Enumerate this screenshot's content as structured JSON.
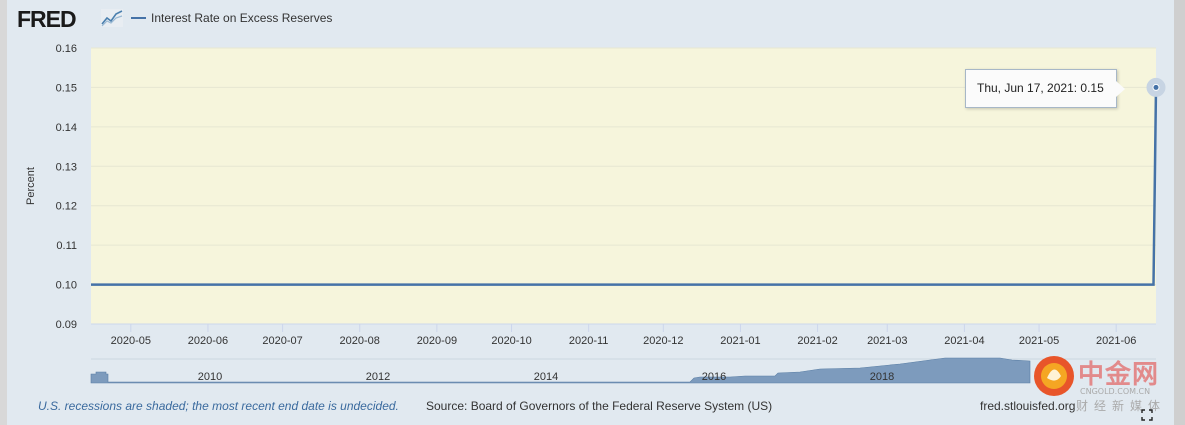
{
  "header": {
    "logo_text": "FRED",
    "legend_label": "Interest Rate on Excess Reserves",
    "series_color": "#4572a7"
  },
  "tooltip": {
    "date": "Thu, Jun 17, 2021",
    "value": "0.15"
  },
  "footer": {
    "note": "U.S. recessions are shaded; the most recent end date is undecided.",
    "source": "Source: Board of Governors of the Federal Reserve System (US)",
    "url": "fred.stlouisfed.org"
  },
  "watermark": {
    "cn": "中金网",
    "url": "CNGOLD.COM.CN",
    "sub": "财经新媒体"
  },
  "chart_data": {
    "type": "line",
    "title": "",
    "xlabel": "",
    "ylabel": "Percent",
    "ylim": [
      0.09,
      0.16
    ],
    "yticks": [
      "0.09",
      "0.10",
      "0.11",
      "0.12",
      "0.13",
      "0.14",
      "0.15",
      "0.16"
    ],
    "xticks": [
      "2020-05",
      "2020-06",
      "2020-07",
      "2020-08",
      "2020-09",
      "2020-10",
      "2020-11",
      "2020-12",
      "2021-01",
      "2021-02",
      "2021-03",
      "2021-04",
      "2021-05",
      "2021-06"
    ],
    "xlim": [
      "2020-04-15",
      "2021-06-17"
    ],
    "plot_background": "#f6f5dc",
    "grid": true,
    "series": [
      {
        "name": "Interest Rate on Excess Reserves",
        "color": "#4572a7",
        "points": [
          {
            "x": "2020-04-15",
            "y": 0.1
          },
          {
            "x": "2021-06-16",
            "y": 0.1
          },
          {
            "x": "2021-06-17",
            "y": 0.15
          }
        ]
      }
    ],
    "navigator": {
      "year_labels": [
        "2010",
        "2012",
        "2014",
        "2016",
        "2018"
      ]
    }
  }
}
